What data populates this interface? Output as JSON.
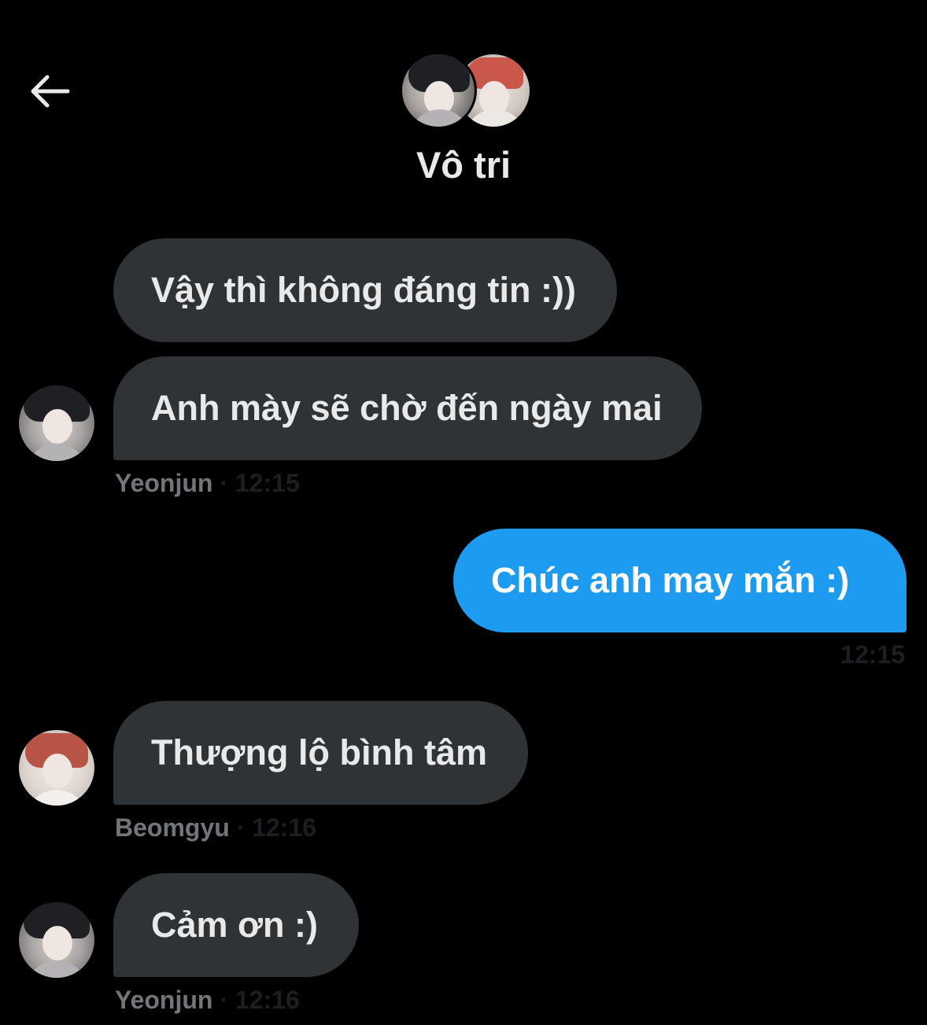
{
  "header": {
    "title": "Vô tri"
  },
  "messages": [
    {
      "text": "Vậy thì không đáng tin :))"
    },
    {
      "text": "Anh mày sẽ chờ đến ngày mai",
      "sender": "Yeonjun",
      "time": "12:15"
    },
    {
      "text": "Chúc anh may mắn :)",
      "time": "12:15"
    },
    {
      "text": "Thượng lộ bình tâm",
      "sender": "Beomgyu",
      "time": "12:16"
    },
    {
      "text": "Cảm ơn :)",
      "sender": "Yeonjun",
      "time": "12:16"
    }
  ],
  "icons": {
    "back": "arrow-left-icon"
  },
  "colors": {
    "background": "#000000",
    "incoming_bubble": "#2f3336",
    "outgoing_bubble": "#1d9bf0",
    "meta_text": "#71767b"
  }
}
